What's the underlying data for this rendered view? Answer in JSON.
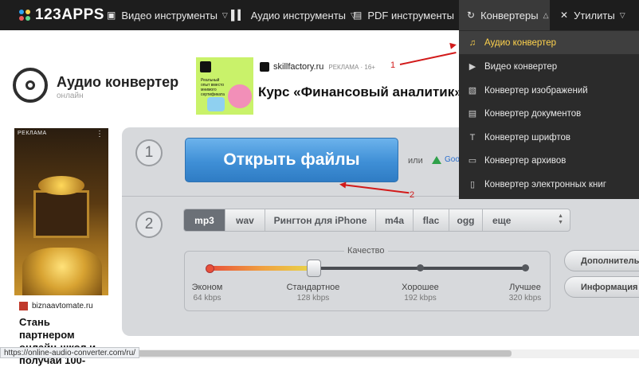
{
  "logo": {
    "text": "123APPS",
    "colors": [
      "#2ea3f2",
      "#ffd34d",
      "#ef5a5a",
      "#5fd68b"
    ]
  },
  "nav": {
    "items": [
      {
        "label": "Видео инструменты",
        "icon": "video-icon"
      },
      {
        "label": "Аудио инструменты",
        "icon": "audio-wave-icon"
      },
      {
        "label": "PDF инструменты",
        "icon": "pdf-file-icon"
      },
      {
        "label": "Конвертеры",
        "icon": "convert-icon",
        "active": true
      },
      {
        "label": "Утилиты",
        "icon": "tools-icon"
      }
    ]
  },
  "dropdown": {
    "items": [
      {
        "label": "Аудио конвертер",
        "icon": "music-note-icon",
        "selected": true
      },
      {
        "label": "Видео конвертер",
        "icon": "video-file-icon"
      },
      {
        "label": "Конвертер изображений",
        "icon": "image-icon"
      },
      {
        "label": "Конвертер документов",
        "icon": "document-icon"
      },
      {
        "label": "Конвертер шрифтов",
        "icon": "font-icon"
      },
      {
        "label": "Конвертер архивов",
        "icon": "archive-icon"
      },
      {
        "label": "Конвертер электронных книг",
        "icon": "book-icon"
      }
    ]
  },
  "page": {
    "title": "Аудио конвертер",
    "subtitle": "онлайн"
  },
  "ad_top": {
    "brand": "skillfactory.ru",
    "tag": "РЕКЛАМА · 16+",
    "headline": "Курс «Финансовый аналитик». П",
    "image_text": "Реальный опыт вместо мнимого сертификата"
  },
  "ad_left": {
    "tag": "РЕКЛАМА",
    "site": "biznaavtomate.ru",
    "text": "Стань партнером онлайн-школ и получай 100-"
  },
  "converter": {
    "step1": "1",
    "step2": "2",
    "open_button": "Открыть файлы",
    "or": "или",
    "gdrive": "Goo",
    "formats": [
      "mp3",
      "wav",
      "Рингтон для iPhone",
      "m4a",
      "flac",
      "ogg",
      "еще"
    ],
    "selected_format": "mp3",
    "quality_label": "Качество",
    "quality_levels": [
      {
        "name": "Эконом",
        "rate": "64 kbps"
      },
      {
        "name": "Стандартное",
        "rate": "128 kbps"
      },
      {
        "name": "Хорошее",
        "rate": "192 kbps"
      },
      {
        "name": "Лучшее",
        "rate": "320 kbps"
      }
    ],
    "selected_quality": "Стандартное",
    "advanced_button": "Дополнитель",
    "info_button": "Информация"
  },
  "annotations": {
    "n1": "1",
    "n2": "2",
    "color": "#d21a1a"
  },
  "status_url": "https://online-audio-converter.com/ru/"
}
